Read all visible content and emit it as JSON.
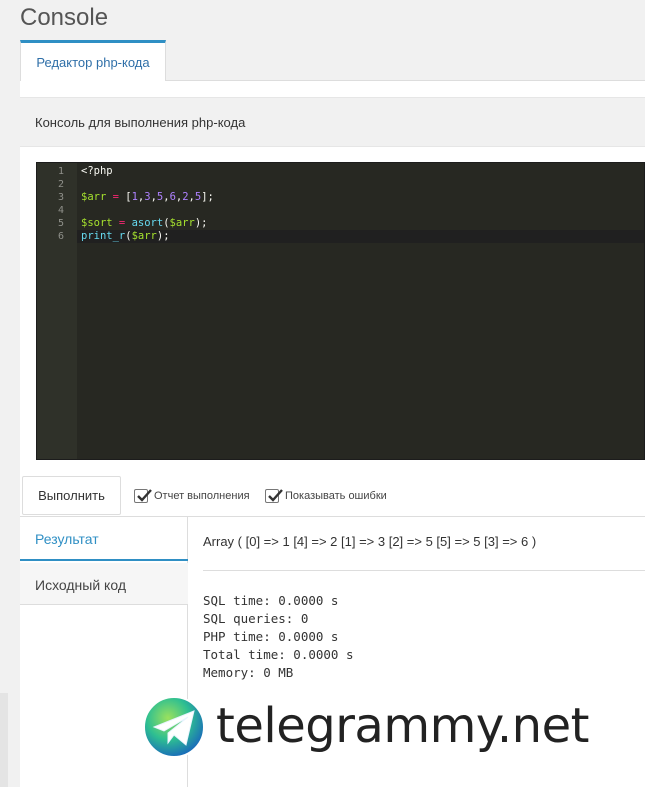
{
  "page": {
    "title": "Console"
  },
  "tabs": [
    {
      "label": "Редактор php-кода"
    }
  ],
  "panel": {
    "heading": "Консоль для выполнения php-кода"
  },
  "editor": {
    "line_numbers": [
      "1",
      "2",
      "3",
      "4",
      "5",
      "6"
    ],
    "lines": [
      [
        {
          "t": "<?php",
          "c": "tag"
        }
      ],
      [],
      [
        {
          "t": "$arr",
          "c": "var"
        },
        {
          "t": " = ",
          "c": "op"
        },
        {
          "t": "[",
          "c": "p"
        },
        {
          "t": "1",
          "c": "num"
        },
        {
          "t": ",",
          "c": "p"
        },
        {
          "t": "3",
          "c": "num"
        },
        {
          "t": ",",
          "c": "p"
        },
        {
          "t": "5",
          "c": "num"
        },
        {
          "t": ",",
          "c": "p"
        },
        {
          "t": "6",
          "c": "num"
        },
        {
          "t": ",",
          "c": "p"
        },
        {
          "t": "2",
          "c": "num"
        },
        {
          "t": ",",
          "c": "p"
        },
        {
          "t": "5",
          "c": "num"
        },
        {
          "t": "];",
          "c": "p"
        }
      ],
      [],
      [
        {
          "t": "$sort",
          "c": "var"
        },
        {
          "t": " = ",
          "c": "op"
        },
        {
          "t": "asort",
          "c": "fn"
        },
        {
          "t": "(",
          "c": "p"
        },
        {
          "t": "$arr",
          "c": "var"
        },
        {
          "t": ");",
          "c": "p"
        }
      ],
      [
        {
          "t": "print_r",
          "c": "fn"
        },
        {
          "t": "(",
          "c": "p"
        },
        {
          "t": "$arr",
          "c": "var"
        },
        {
          "t": ");",
          "c": "p"
        }
      ]
    ],
    "active_line": 6,
    "colors": {
      "background": "#272822",
      "gutter": "#2f3129"
    }
  },
  "toolbar": {
    "run_label": "Выполнить",
    "checkboxes": [
      {
        "label": "Отчет выполнения",
        "checked": true
      },
      {
        "label": "Показывать ошибки",
        "checked": true
      }
    ]
  },
  "side_tabs": [
    {
      "label": "Результат",
      "active": true
    },
    {
      "label": "Исходный код",
      "active": false
    }
  ],
  "result": {
    "output": "Array ( [0] => 1 [4] => 2 [1] => 3 [2] => 5 [5] => 5 [3] => 6 )",
    "stats": [
      "SQL time: 0.0000 s",
      "SQL queries: 0",
      "PHP time: 0.0000 s",
      "Total time: 0.0000 s",
      "Memory: 0 MB"
    ]
  },
  "watermark": {
    "text": "telegrammy.net",
    "icon": "telegram-globe-icon"
  },
  "colors": {
    "accent": "#2f8fc4",
    "tab_text": "#2f6fa8"
  }
}
